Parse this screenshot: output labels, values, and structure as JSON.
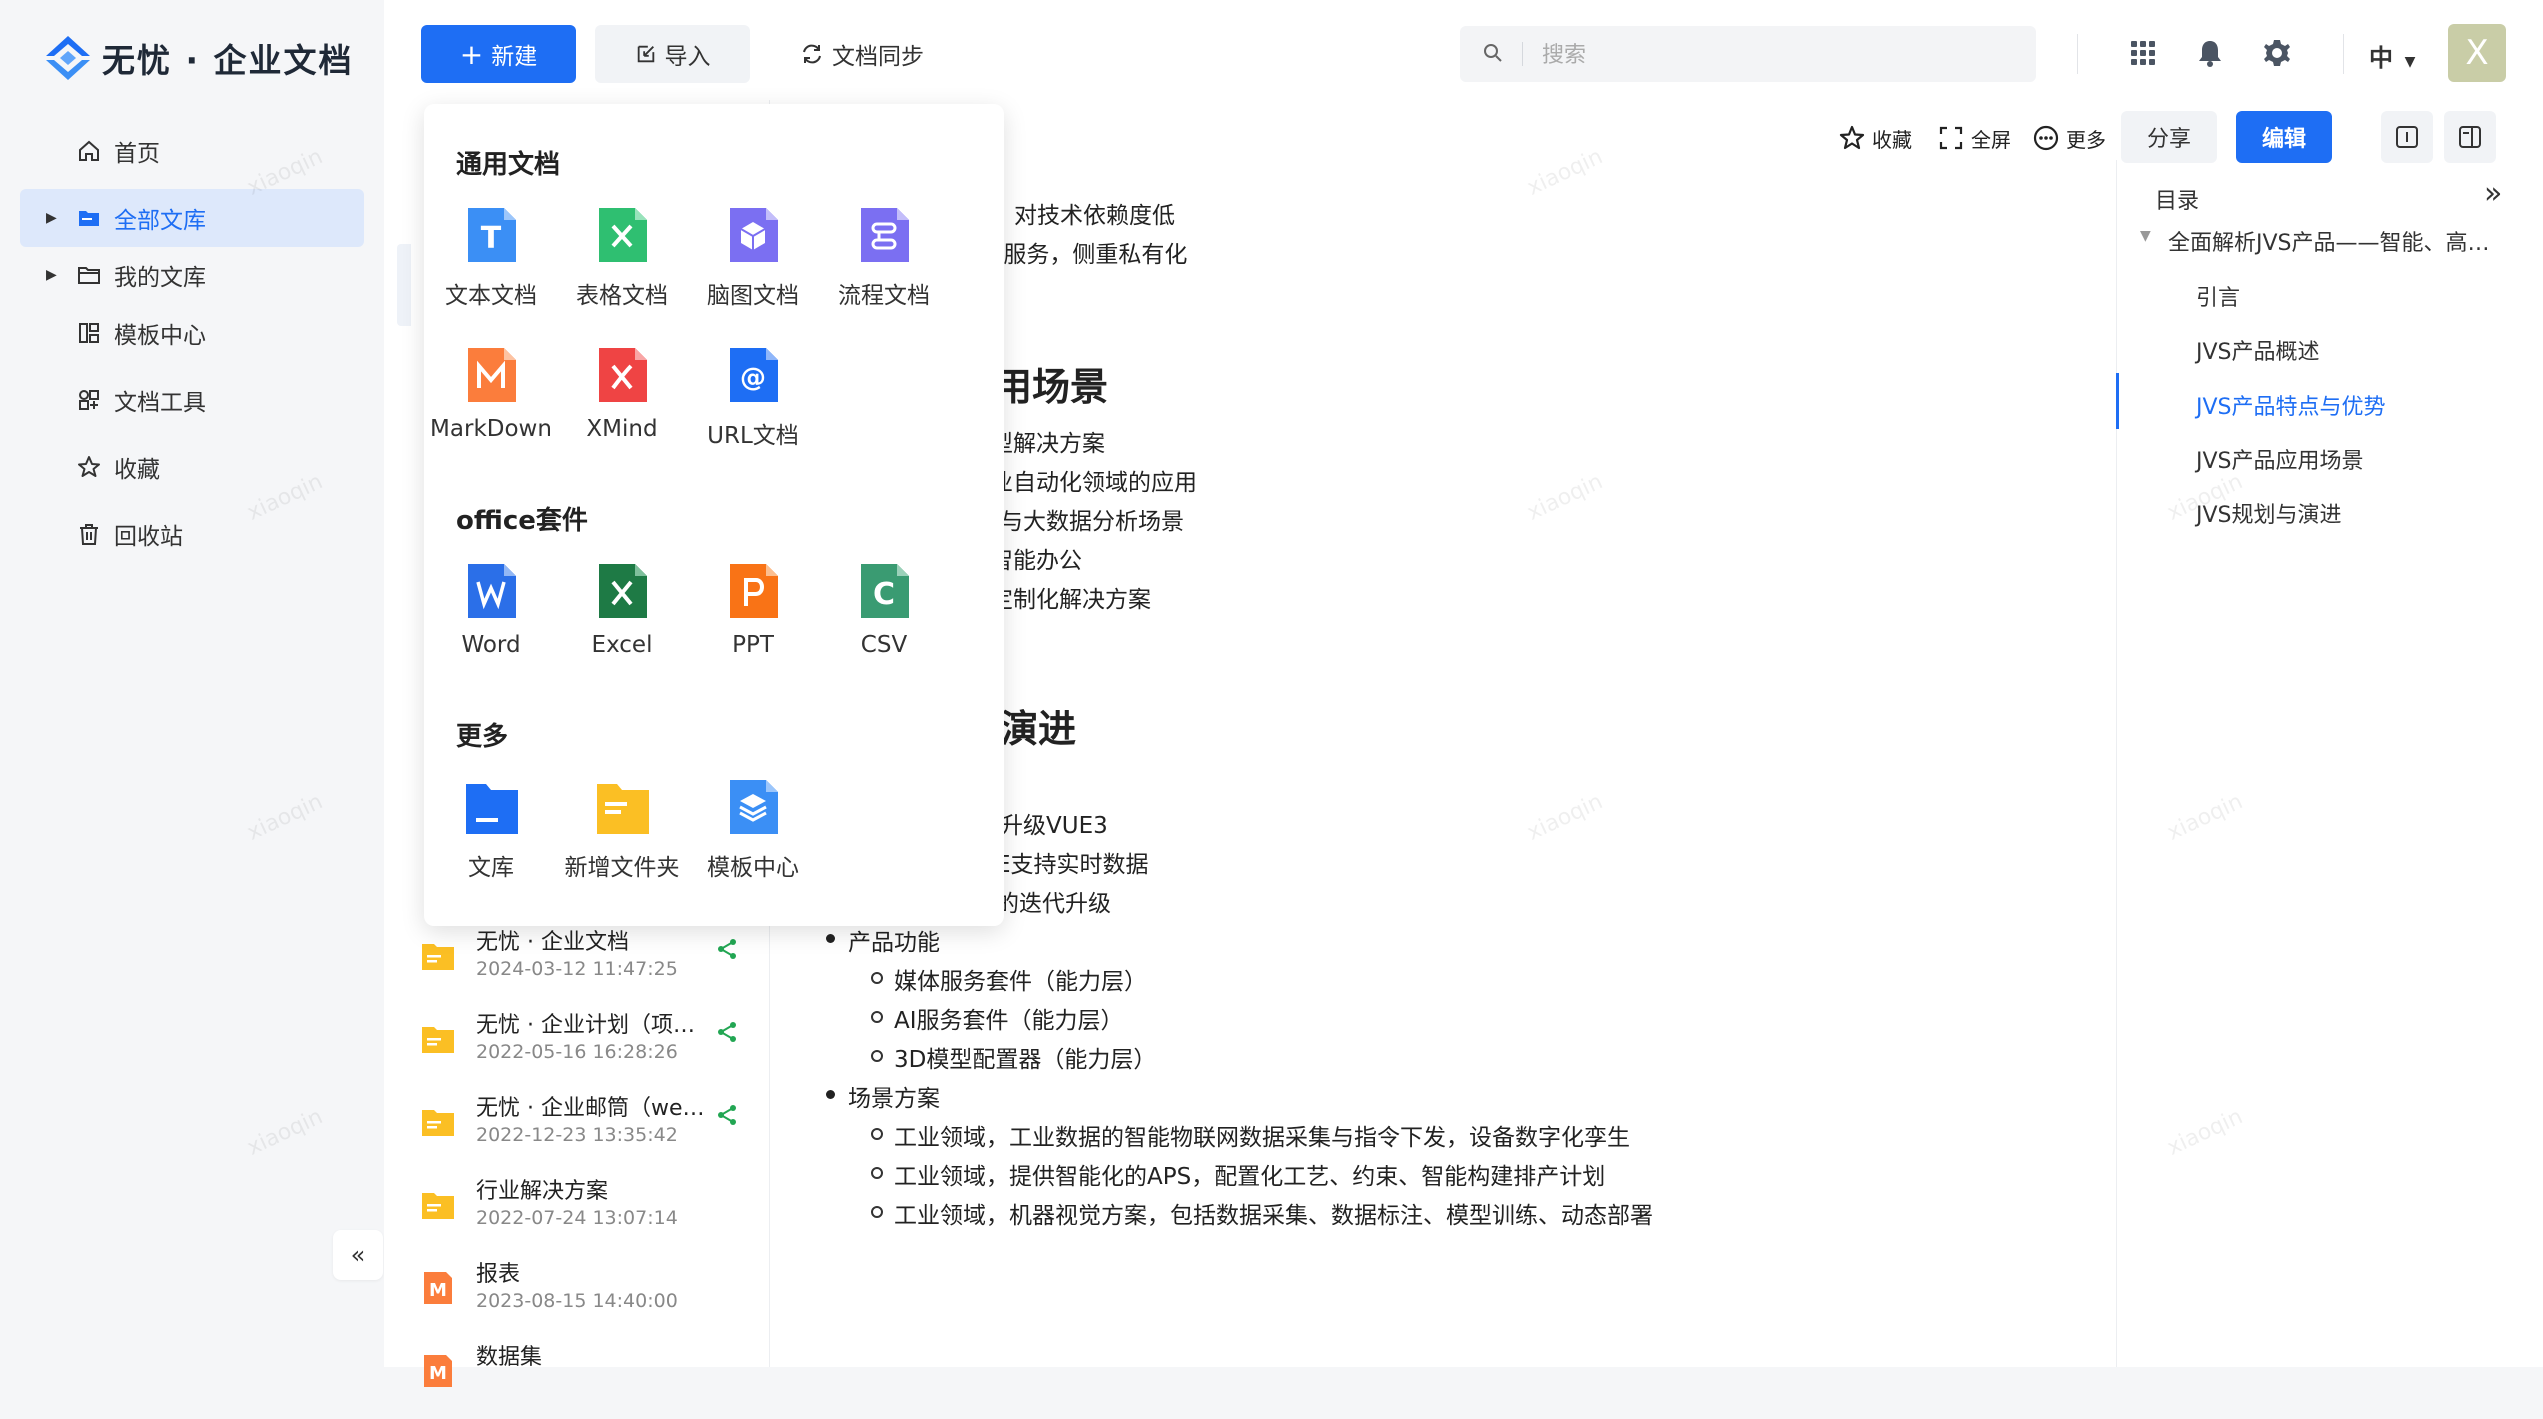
{
  "app": {
    "logo_text": "无忧 · 企业文档"
  },
  "sidebar": {
    "items": [
      {
        "label": "首页",
        "icon": "home-icon"
      },
      {
        "label": "全部文库",
        "icon": "folder-icon",
        "active": true
      },
      {
        "label": "我的文库",
        "icon": "folder-icon"
      },
      {
        "label": "模板中心",
        "icon": "template-icon"
      },
      {
        "label": "文档工具",
        "icon": "tools-icon"
      },
      {
        "label": "收藏",
        "icon": "star-icon"
      },
      {
        "label": "回收站",
        "icon": "trash-icon"
      }
    ],
    "collapse_glyph": "«"
  },
  "toolbar": {
    "new_label": "新建",
    "import_label": "导入",
    "sync_label": "文档同步",
    "search_placeholder": "搜索",
    "lang_label": "中",
    "avatar_initial": "X"
  },
  "doc_toolbar": {
    "favorite_label": "收藏",
    "fullscreen_label": "全屏",
    "more_label": "更多",
    "share_label": "分享",
    "edit_label": "编辑"
  },
  "new_menu": {
    "sections": [
      {
        "title": "通用文档",
        "items": [
          {
            "label": "文本文档",
            "color": "#3b8ff5",
            "glyph": "T"
          },
          {
            "label": "表格文档",
            "color": "#2fbf71",
            "glyph": "✕"
          },
          {
            "label": "脑图文档",
            "color": "#7b6ff2",
            "glyph": "⬢"
          },
          {
            "label": "流程文档",
            "color": "#7b6ff2",
            "glyph": "⇋"
          },
          {
            "label": "MarkDown",
            "color": "#fb7d3c",
            "glyph": "M"
          },
          {
            "label": "XMind",
            "color": "#ef4444",
            "glyph": "X"
          },
          {
            "label": "URL文档",
            "color": "#1e6ef4",
            "glyph": "@"
          }
        ]
      },
      {
        "title": "office套件",
        "items": [
          {
            "label": "Word",
            "color": "#2b6fe8",
            "glyph": "W"
          },
          {
            "label": "Excel",
            "color": "#1e7a45",
            "glyph": "X"
          },
          {
            "label": "PPT",
            "color": "#f97316",
            "glyph": "P"
          },
          {
            "label": "CSV",
            "color": "#3a9b72",
            "glyph": "C"
          }
        ]
      },
      {
        "title": "更多",
        "items": [
          {
            "label": "文库",
            "color": "#1e6ef4",
            "glyph": ""
          },
          {
            "label": "新增文件夹",
            "color": "#fbbf24",
            "glyph": ""
          },
          {
            "label": "模板中心",
            "color": "#3b8ff5",
            "glyph": ""
          }
        ]
      }
    ]
  },
  "file_list": [
    {
      "name": "无忧 · 企业文档",
      "date": "2024-03-12 11:47:25",
      "type": "folder",
      "shared": true
    },
    {
      "name": "无忧 · 企业计划（项目管理）",
      "date": "2022-05-16 16:28:26",
      "type": "folder",
      "shared": true
    },
    {
      "name": "无忧 · 企业邮筒（webmail）",
      "date": "2022-12-23 13:35:42",
      "type": "folder",
      "shared": true
    },
    {
      "name": "行业解决方案",
      "date": "2022-07-24 13:07:14",
      "type": "folder",
      "shared": false
    },
    {
      "name": "报表",
      "date": "2023-08-15 14:40:00",
      "type": "markdown",
      "shared": false
    },
    {
      "name": "数据集",
      "date": "",
      "type": "markdown",
      "shared": false
    }
  ],
  "doc": {
    "partial_lines_top": [
      "对技术依赖度低",
      "k服务，侧重私有化"
    ],
    "heading_usecases": "用场景",
    "usecase_lines": [
      "型解决方案",
      "业自动化领域的应用",
      "与大数据分析场景",
      "智能办公",
      "定制化解决方案"
    ],
    "heading_roadmap": "演进",
    "roadmap_lines": [
      "升级VUE3",
      "E支持实时数据",
      "的迭代升级"
    ],
    "bullets": [
      {
        "text": "产品功能",
        "children": [
          "媒体服务套件（能力层）",
          "AI服务套件（能力层）",
          "3D模型配置器（能力层）"
        ]
      },
      {
        "text": "场景方案",
        "children": [
          "工业领域，工业数据的智能物联网数据采集与指令下发，设备数字化孪生",
          "工业领域，提供智能化的APS，配置化工艺、约束、智能构建排产计划",
          "工业领域，机器视觉方案，包括数据采集、数据标注、模型训练、动态部署"
        ]
      }
    ]
  },
  "toc": {
    "title": "目录",
    "expand_glyph": "»",
    "root": "全面解析JVS产品——智能、高效、灵活的企业数字化解决方案",
    "items": [
      {
        "label": "引言"
      },
      {
        "label": "JVS产品概述"
      },
      {
        "label": "JVS产品特点与优势",
        "active": true
      },
      {
        "label": "JVS产品应用场景"
      },
      {
        "label": "JVS规划与演进"
      }
    ]
  },
  "watermark": "xiaoqin",
  "colors": {
    "accent": "#1e6ef4",
    "folder": "#fbbf24",
    "share": "#22a653"
  }
}
